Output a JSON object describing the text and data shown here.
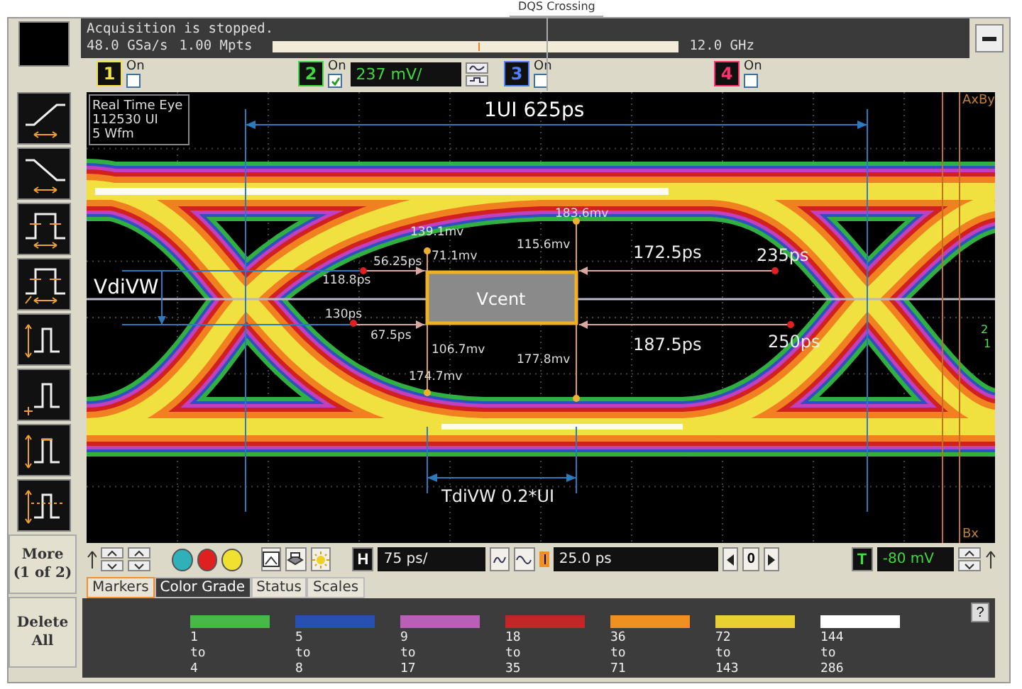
{
  "cursor_label": "DQS Crossing",
  "status": {
    "message": "Acquisition is stopped.",
    "sample_rate": "48.0 GSa/s",
    "memory_depth": "1.00 Mpts",
    "bandwidth": "12.0 GHz"
  },
  "channels": [
    {
      "number": "1",
      "color": "#f0e040",
      "label": "On",
      "checked": false
    },
    {
      "number": "2",
      "color": "#40d840",
      "label": "On",
      "checked": true,
      "scale": "237 mV/"
    },
    {
      "number": "3",
      "color": "#5080ff",
      "label": "On",
      "checked": false
    },
    {
      "number": "4",
      "color": "#ff3070",
      "label": "On",
      "checked": false
    }
  ],
  "measurements": [
    {
      "kind": "rising"
    },
    {
      "kind": "falling"
    },
    {
      "kind": "pulse"
    },
    {
      "kind": "pulse-fraction"
    },
    {
      "kind": "amplitude"
    },
    {
      "kind": "base"
    },
    {
      "kind": "top"
    },
    {
      "kind": "level"
    }
  ],
  "side_buttons": [
    {
      "lines": [
        "More",
        "(1 of 2)"
      ]
    },
    {
      "lines": [
        "Delete",
        "All"
      ]
    }
  ],
  "eye": {
    "info": [
      "Real Time Eye",
      "112530 UI",
      "5 Wfm"
    ],
    "center_box": "Vcent",
    "annotations": [
      {
        "kind": "large",
        "text": "1UI 625ps"
      },
      {
        "kind": "large",
        "text": "VdiVW"
      },
      {
        "kind": "small",
        "text": "139.1mv"
      },
      {
        "kind": "small",
        "text": "56.25ps"
      },
      {
        "kind": "small",
        "text": "71.1mv"
      },
      {
        "kind": "small",
        "text": "118.8ps"
      },
      {
        "kind": "small",
        "text": "130ps"
      },
      {
        "kind": "small",
        "text": "67.5ps"
      },
      {
        "kind": "small",
        "text": "106.7mv"
      },
      {
        "kind": "small",
        "text": "174.7mv"
      },
      {
        "kind": "small",
        "text": "183.6mv"
      },
      {
        "kind": "small",
        "text": "115.6mv"
      },
      {
        "kind": "medium",
        "text": "172.5ps"
      },
      {
        "kind": "medium",
        "text": "235ps"
      },
      {
        "kind": "medium",
        "text": "187.5ps"
      },
      {
        "kind": "medium",
        "text": "250ps"
      },
      {
        "kind": "small",
        "text": "177.8mv"
      },
      {
        "kind": "medium",
        "text": "TdiVW 0.2*UI"
      },
      {
        "kind": "cursor",
        "text": "AxBy"
      },
      {
        "kind": "cursor",
        "text": "Bx"
      },
      {
        "kind": "marker",
        "text": "2"
      },
      {
        "kind": "marker",
        "text": "1"
      }
    ]
  },
  "color_buttons": [
    {
      "color": "#30b0b8"
    },
    {
      "color": "#e02020"
    },
    {
      "color": "#f0e030"
    }
  ],
  "controls": {
    "horizontal_button": "H",
    "horizontal_scale": "75 ps/",
    "delay": "25.0 ps",
    "delay_step": "0",
    "trigger_button": "T",
    "trigger_level": "-80 mV"
  },
  "tabs": [
    {
      "label": "Markers",
      "selected": false,
      "focused": true
    },
    {
      "label": "Color Grade",
      "selected": true,
      "focused": false
    },
    {
      "label": "Status",
      "selected": false,
      "focused": false
    },
    {
      "label": "Scales",
      "selected": false,
      "focused": false
    }
  ],
  "color_grade": {
    "help": "?",
    "ranges": [
      {
        "color": "#48b848",
        "from": "1",
        "joiner": "to",
        "to": "4"
      },
      {
        "color": "#2850b0",
        "from": "5",
        "joiner": "to",
        "to": "8"
      },
      {
        "color": "#b860b8",
        "from": "9",
        "joiner": "to",
        "to": "17"
      },
      {
        "color": "#c02828",
        "from": "18",
        "joiner": "to",
        "to": "35"
      },
      {
        "color": "#f09020",
        "from": "36",
        "joiner": "to",
        "to": "71"
      },
      {
        "color": "#e8d030",
        "from": "72",
        "joiner": "to",
        "to": "143"
      },
      {
        "color": "#ffffff",
        "from": "144",
        "joiner": "to",
        "to": "286"
      }
    ]
  }
}
